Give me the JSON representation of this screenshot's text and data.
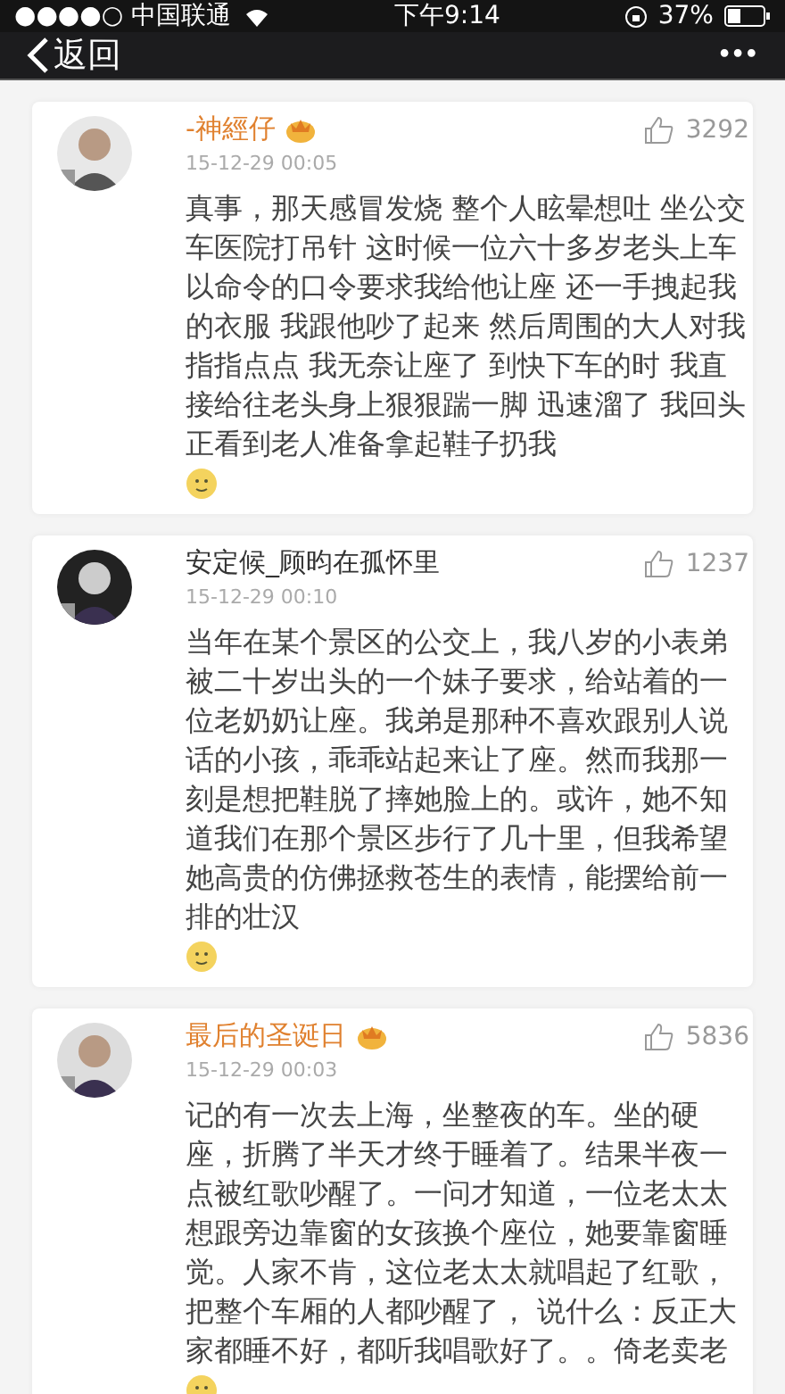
{
  "status_bar": {
    "carrier": "●●●●○ 中国联通",
    "time": "下午9:14",
    "battery": "37%"
  },
  "nav": {
    "back": "返回",
    "more": "•••"
  },
  "comments": [
    {
      "user": "-神經仔",
      "vip": true,
      "date": "15-12-29 00:05",
      "likes": "3292",
      "text": "真事，那天感冒发烧 整个人眩晕想吐 坐公交车医院打吊针 这时候一位六十多岁老头上车以命令的口令要求我给他让座 还一手拽起我的衣服 我跟他吵了起来 然后周围的大人对我指指点点 我无奈让座了 到快下车的时 我直接给往老头身上狠狠踹一脚 迅速溜了 我回头正看到老人准备拿起鞋子扔我"
    },
    {
      "user": "安定候_顾昀在孤怀里",
      "vip": false,
      "date": "15-12-29 00:10",
      "likes": "1237",
      "text": "当年在某个景区的公交上，我八岁的小表弟被二十岁出头的一个妹子要求，给站着的一位老奶奶让座。我弟是那种不喜欢跟别人说话的小孩，乖乖站起来让了座。然而我那一刻是想把鞋脱了摔她脸上的。或许，她不知道我们在那个景区步行了几十里，但我希望她高贵的仿佛拯救苍生的表情，能摆给前一排的壮汉"
    },
    {
      "user": "最后的圣诞日",
      "vip": true,
      "date": "15-12-29 00:03",
      "likes": "5836",
      "text": "记的有一次去上海，坐整夜的车。坐的硬座，折腾了半天才终于睡着了。结果半夜一点被红歌吵醒了。一问才知道，一位老太太想跟旁边靠窗的女孩换个座位，她要靠窗睡觉。人家不肯，这位老太太就唱起了红歌，把整个车厢的人都吵醒了， 说什么：反正大家都睡不好，都听我唱歌好了。。倚老卖老"
    }
  ]
}
